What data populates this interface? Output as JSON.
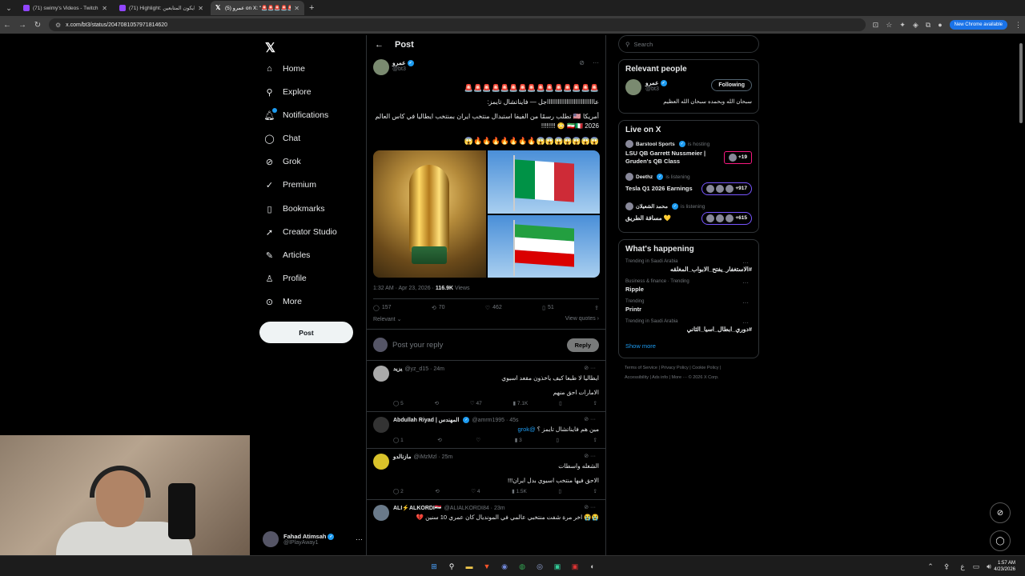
{
  "browser": {
    "tabs": [
      {
        "title": "(71) swimy's Videos - Twitch",
        "active": false
      },
      {
        "title": "(71) Highlight: رايكون المتابعين",
        "active": false
      },
      {
        "title": "(5) عمرو on X: \"🚨🚨🚨🚨🚨🚨",
        "active": true
      }
    ],
    "url": "x.com/bt3/status/2047081057971814620",
    "new_chrome_label": "New Chrome available"
  },
  "nav": {
    "items": [
      {
        "label": "Home",
        "icon": "home-icon"
      },
      {
        "label": "Explore",
        "icon": "search-icon"
      },
      {
        "label": "Notifications",
        "icon": "bell-icon"
      },
      {
        "label": "Chat",
        "icon": "chat-icon"
      },
      {
        "label": "Grok",
        "icon": "grok-icon"
      },
      {
        "label": "Premium",
        "icon": "premium-icon"
      },
      {
        "label": "Bookmarks",
        "icon": "bookmark-icon"
      },
      {
        "label": "Creator Studio",
        "icon": "rocket-icon"
      },
      {
        "label": "Articles",
        "icon": "articles-icon"
      },
      {
        "label": "Profile",
        "icon": "profile-icon"
      },
      {
        "label": "More",
        "icon": "more-icon"
      }
    ],
    "post_label": "Post",
    "account": {
      "name": "Fahad Atimsah",
      "handle": "@IPlayAway1"
    }
  },
  "post": {
    "header": "Post",
    "author_name": "عمرو",
    "author_handle": "@bt3",
    "line1": "🚨🚨🚨🚨🚨🚨🚨🚨🚨🚨🚨🚨🚨🚨🚨",
    "line2": "عاااااااااااااااااااااااااااجل — فايناتشال تايمز:",
    "line3": "أمريكا 🇺🇸 تطلب رسمًا من الفيفا استبدال منتخب ايران بمنتخب ايطاليا في كاس العالم 2026 🇮🇷🇮🇹 😳 !!!!!!!!",
    "line4": "😱😱😱😱😱😱😱🔥🔥🔥🔥🔥🔥🔥😱",
    "time": "1:32 AM · Apr 23, 2026 · ",
    "views": "116.9K",
    "views_label": " Views",
    "stats": {
      "replies": "157",
      "reposts": "70",
      "likes": "462",
      "bookmarks": "51"
    },
    "relevant": "Relevant",
    "view_quotes": "View quotes"
  },
  "reply_box": {
    "placeholder": "Post your reply",
    "button": "Reply"
  },
  "replies": [
    {
      "name": "يزيد",
      "handle": "@yz_d15 · 24m",
      "text1": "ايطاليا لا طبعا كيف ياخذون مقعد اسيوي",
      "text2": "الامارات احق منهم",
      "stats": [
        "5",
        "",
        "47",
        "7.1K"
      ]
    },
    {
      "name": "Abdullah Riyad | المهندس",
      "handle": "@amrm1995 · 45s",
      "text1": "مين هم فايناتشال تايمز ؟",
      "mention": "@grok",
      "text2": "",
      "stats": [
        "1",
        "",
        "",
        "3"
      ]
    },
    {
      "name": "مازنالدو",
      "handle": "@iMzMzl · 25m",
      "text1": "الشغله واسطات",
      "text2": "الاحق فيها منتخب اسيوي بدل ايران!!!",
      "stats": [
        "2",
        "",
        "4",
        "1.5K"
      ]
    },
    {
      "name": "ALI⚡ALKORDI🇮🇶",
      "handle": "@ALIALKORDI84 · 23m",
      "text1": "😭😭 اخر مرة شفت منتخبي عالمي في المونديال كان عمري 10 سنين 💔",
      "text2": "",
      "stats": [
        "",
        "",
        "",
        ""
      ]
    }
  ],
  "search": {
    "placeholder": "Search"
  },
  "relevant_people": {
    "title": "Relevant people",
    "name": "عمرو",
    "handle": "@bt3",
    "bio": "سبحان الله وبحمده سبحان الله العظيم",
    "follow_label": "Following"
  },
  "live": {
    "title": "Live on X",
    "items": [
      {
        "host": "Barstool Sports",
        "status": "is hosting",
        "title": "LSU QB Garrett Nussmeier | Gruden's QB Class",
        "count": "+19"
      },
      {
        "host": "Deethz",
        "status": "is listening",
        "title": "Tesla Q1 2026 Earnings",
        "count": "+917"
      },
      {
        "host": "محمد الشعيلان",
        "status": "is listening",
        "title": "مسافة الطريق 💛",
        "count": "+615"
      }
    ]
  },
  "happening": {
    "title": "What's happening",
    "items": [
      {
        "context": "Trending in Saudi Arabia",
        "topic": "#الاستغفار_يفتح_الابواب_المغلقه"
      },
      {
        "context": "Business & finance · Trending",
        "topic": "Ripple"
      },
      {
        "context": "Trending",
        "topic": "Printr"
      },
      {
        "context": "Trending in Saudi Arabia",
        "topic": "#دوري_ابطال_اسيا_الثاني"
      }
    ],
    "show_more": "Show more"
  },
  "footer": {
    "links": [
      "Terms of Service",
      "Privacy Policy",
      "Cookie Policy",
      "Accessibility",
      "Ads info",
      "More ···",
      "© 2026 X Corp."
    ]
  },
  "taskbar": {
    "time": "1:57 AM",
    "date": "4/23/2026"
  }
}
